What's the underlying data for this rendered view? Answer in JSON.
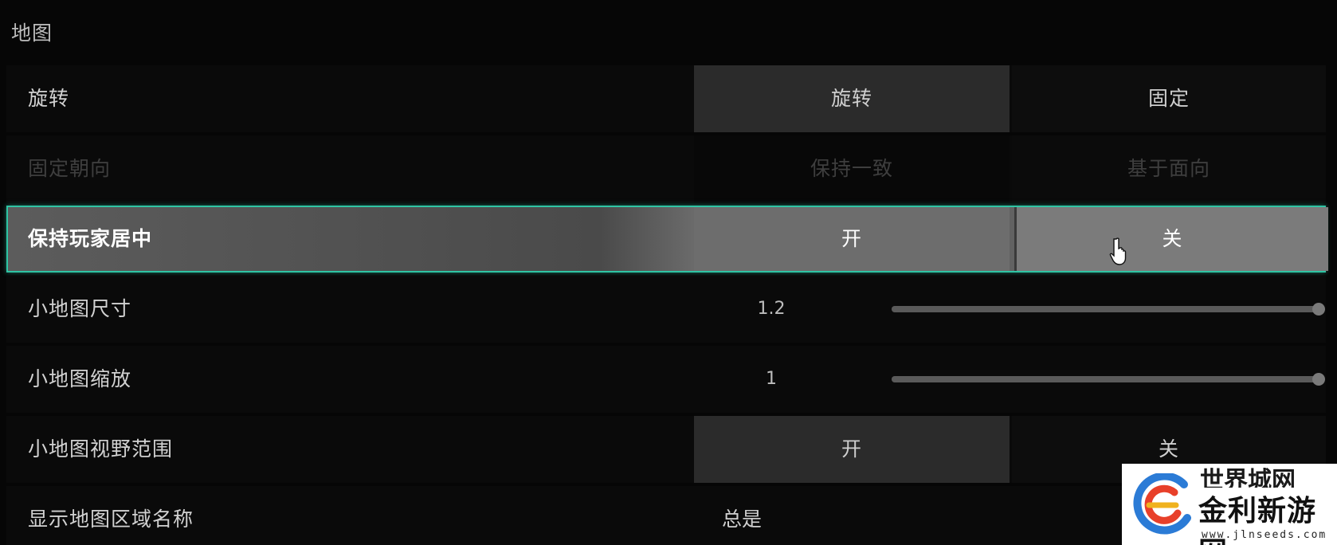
{
  "section": {
    "title": "地图"
  },
  "rows": {
    "rotate": {
      "label": "旋转",
      "option_a": "旋转",
      "option_b": "固定",
      "selected": "旋转"
    },
    "fixed_direction": {
      "label": "固定朝向",
      "option_a": "保持一致",
      "option_b": "基于面向",
      "disabled": true
    },
    "keep_player_centered": {
      "label": "保持玩家居中",
      "option_a": "开",
      "option_b": "关",
      "focused": true
    },
    "minimap_size": {
      "label": "小地图尺寸",
      "value": "1.2",
      "slider_fraction": 1.0
    },
    "minimap_zoom": {
      "label": "小地图缩放",
      "value": "1",
      "slider_fraction": 1.0
    },
    "minimap_view_range": {
      "label": "小地图视野范围",
      "option_a": "开",
      "option_b": "关",
      "selected": "开"
    },
    "show_area_names": {
      "label": "显示地图区域名称",
      "value": "总是"
    }
  },
  "watermark": {
    "top_text": "世界城网",
    "main_text": "金利新游网",
    "url": "www.jlnseeds.com"
  },
  "colors": {
    "focus_border": "#2fc4a4",
    "background": "#060606"
  }
}
